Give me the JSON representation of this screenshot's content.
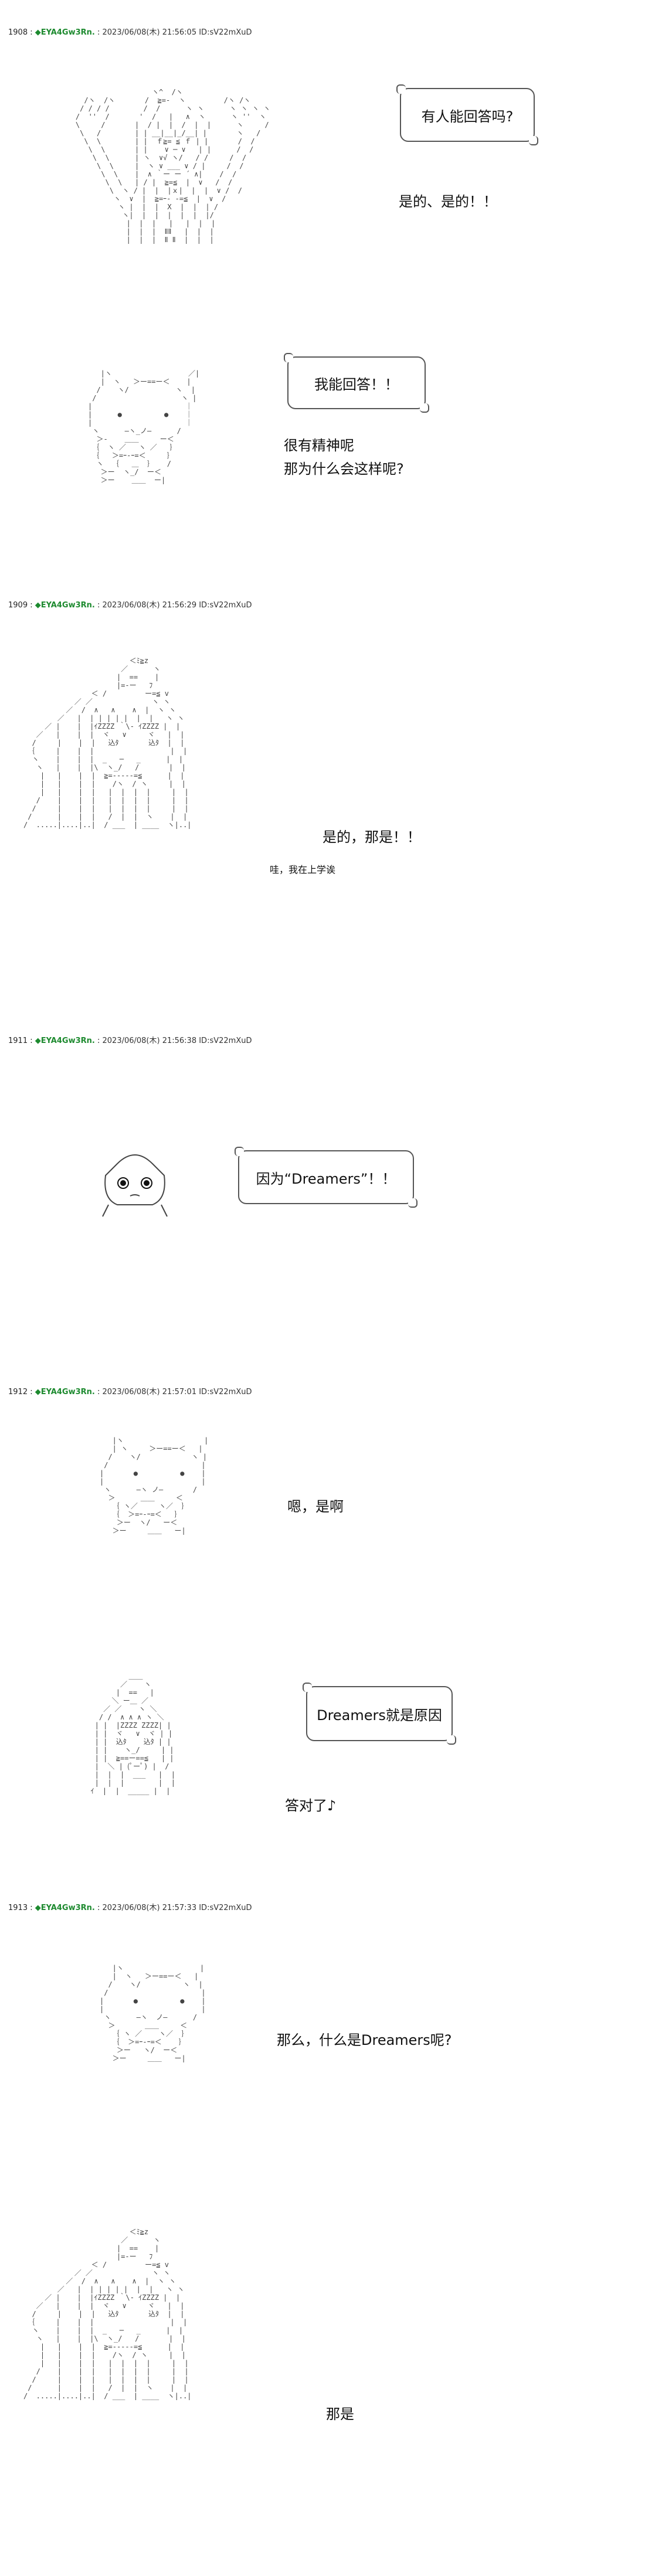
{
  "posts": [
    {
      "num": "1908",
      "name": "◆EYA4Gw3Rn.",
      "meta": "2023/06/08(木) 21:56:05 ID:sV22mXuD"
    },
    {
      "num": "1909",
      "name": "◆EYA4Gw3Rn.",
      "meta": "2023/06/08(木) 21:56:29 ID:sV22mXuD"
    },
    {
      "num": "1911",
      "name": "◆EYA4Gw3Rn.",
      "meta": "2023/06/08(木) 21:56:38 ID:sV22mXuD"
    },
    {
      "num": "1912",
      "name": "◆EYA4Gw3Rn.",
      "meta": "2023/06/08(木) 21:57:01 ID:sV22mXuD"
    },
    {
      "num": "1913",
      "name": "◆EYA4Gw3Rn.",
      "meta": "2023/06/08(木) 21:57:33 ID:sV22mXuD"
    }
  ],
  "dialogue": {
    "b1": "有人能回答吗?",
    "t1": "是的、是的！！",
    "b2": "我能回答！！",
    "t2": "很有精神呢\n那为什么会这样呢?",
    "t3": "是的，那是！！",
    "s3": "哇，我在上学诶",
    "b4": "因为“Dreamers”！！",
    "t5": "嗯，是啊",
    "b6": "Dreamers就是原因",
    "t6": "答对了♪",
    "t7": "那么，什么是Dreamers呢?",
    "t8": "那是"
  }
}
